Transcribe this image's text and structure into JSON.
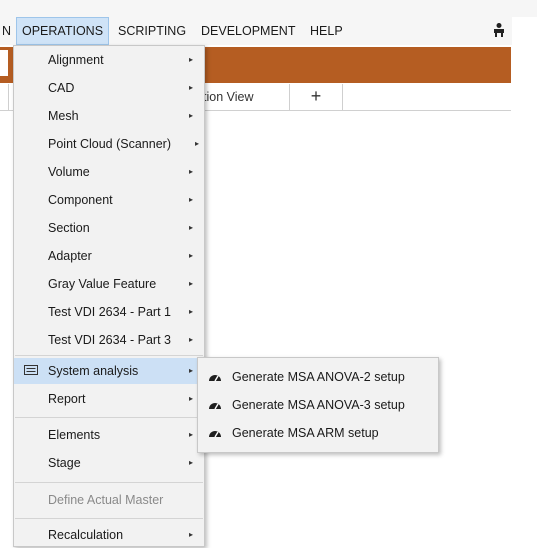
{
  "menubar": {
    "items": [
      {
        "label": "N"
      },
      {
        "label": "OPERATIONS"
      },
      {
        "label": "SCRIPTING"
      },
      {
        "label": "DEVELOPMENT"
      },
      {
        "label": "HELP"
      }
    ]
  },
  "tabs": {
    "view_label": "tion View",
    "add_label": "+"
  },
  "operations_menu": {
    "items": [
      {
        "label": "Alignment",
        "has_submenu": true
      },
      {
        "label": "CAD",
        "has_submenu": true
      },
      {
        "label": "Mesh",
        "has_submenu": true
      },
      {
        "label": "Point Cloud (Scanner)",
        "has_submenu": true
      },
      {
        "label": "Volume",
        "has_submenu": true
      },
      {
        "label": "Component",
        "has_submenu": true
      },
      {
        "label": "Section",
        "has_submenu": true
      },
      {
        "label": "Adapter",
        "has_submenu": true
      },
      {
        "label": "Gray Value Feature",
        "has_submenu": true
      },
      {
        "label": "Test VDI 2634 - Part 1",
        "has_submenu": true
      },
      {
        "label": "Test VDI 2634 - Part 3",
        "has_submenu": true
      },
      {
        "label": "System analysis",
        "has_submenu": true,
        "icon": "window-icon",
        "highlighted": true
      },
      {
        "label": "Report",
        "has_submenu": true
      },
      {
        "label": "Elements",
        "has_submenu": true
      },
      {
        "label": "Stage",
        "has_submenu": true
      },
      {
        "label": "Define Actual Master",
        "disabled": true
      },
      {
        "label": "Recalculation",
        "has_submenu": true
      }
    ],
    "arrow_glyph": "▸"
  },
  "system_analysis_submenu": {
    "items": [
      {
        "label": "Generate MSA ANOVA-2 setup",
        "icon": "gauge-icon"
      },
      {
        "label": "Generate MSA ANOVA-3 setup",
        "icon": "gauge-icon"
      },
      {
        "label": "Generate MSA ARM setup",
        "icon": "gauge-icon"
      }
    ]
  },
  "colors": {
    "accent_band": "#b55d22",
    "highlight": "#cce0f5",
    "menu_bg": "#f2f2f2"
  }
}
